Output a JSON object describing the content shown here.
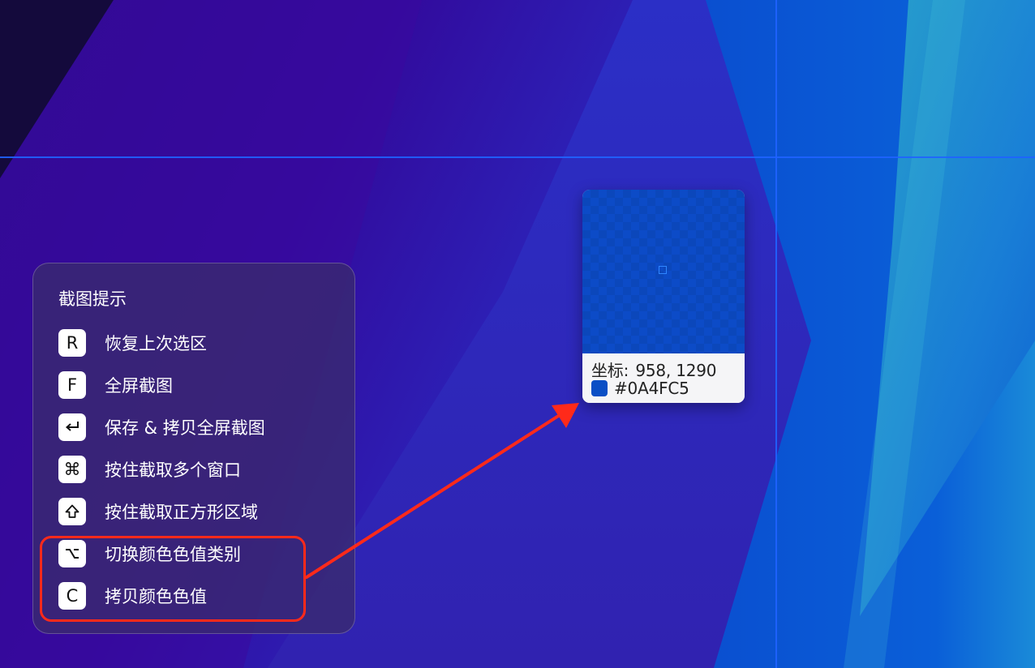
{
  "colors": {
    "crosshair": "#1f63ff",
    "sampled_color": "#0A4FC5",
    "annotation": "#ff2a1a"
  },
  "magnifier": {
    "coord_label": "坐标:",
    "coord_value": "958, 1290",
    "hex_value": "#0A4FC5"
  },
  "hints": {
    "title": "截图提示",
    "items": [
      {
        "key": "R",
        "key_icon": "letter-r",
        "label": "恢复上次选区"
      },
      {
        "key": "F",
        "key_icon": "letter-f",
        "label": "全屏截图"
      },
      {
        "key": "↵",
        "key_icon": "return-icon",
        "label": "保存 & 拷贝全屏截图"
      },
      {
        "key": "⌘",
        "key_icon": "command-icon",
        "label": "按住截取多个窗口"
      },
      {
        "key": "⇧",
        "key_icon": "shift-icon",
        "label": "按住截取正方形区域"
      },
      {
        "key": "⌥",
        "key_icon": "option-icon",
        "label": "切换颜色色值类别"
      },
      {
        "key": "C",
        "key_icon": "letter-c",
        "label": "拷贝颜色色值"
      }
    ]
  }
}
